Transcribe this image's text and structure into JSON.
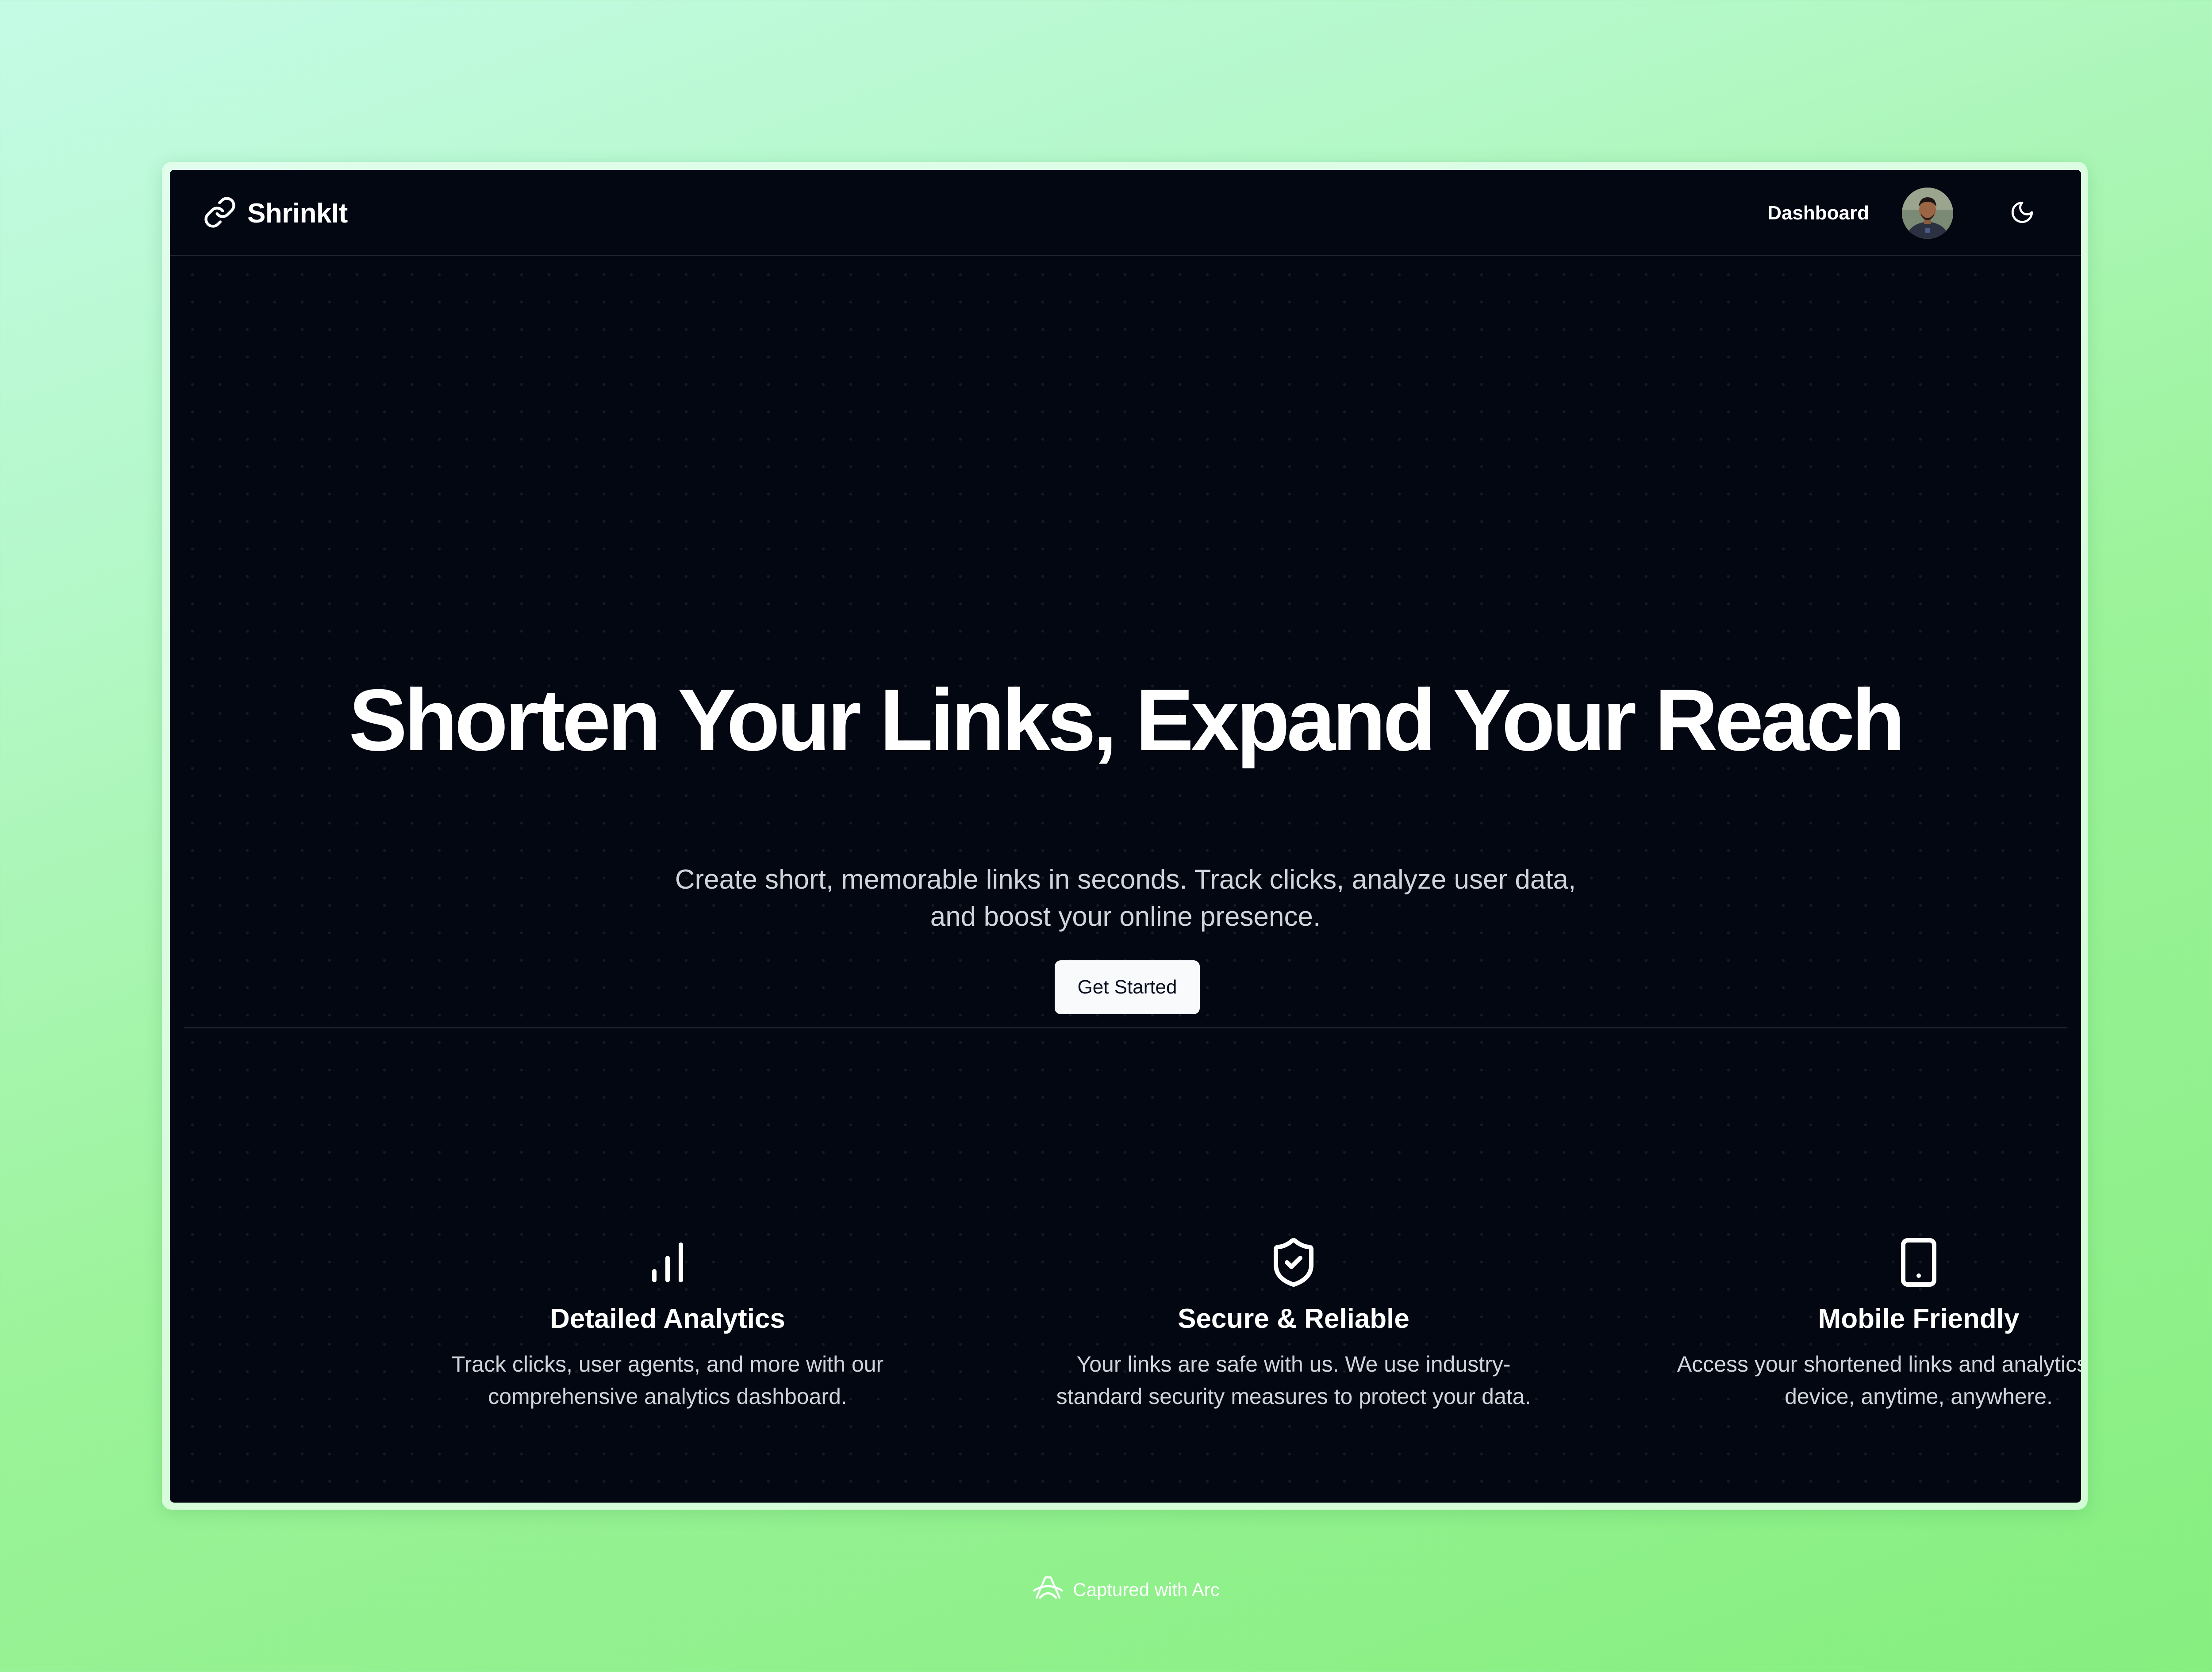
{
  "brand": {
    "name": "ShrinkIt"
  },
  "nav": {
    "dashboard_label": "Dashboard"
  },
  "hero": {
    "title": "Shorten Your Links, Expand Your Reach",
    "subtitle_line1": "Create short, memorable links in seconds. Track clicks, analyze user data,",
    "subtitle_line2": "and boost your online presence.",
    "cta_label": "Get Started"
  },
  "features": [
    {
      "icon": "bar-chart-icon",
      "title": "Detailed Analytics",
      "desc_line1": "Track clicks, user agents, and more with our",
      "desc_line2": "comprehensive analytics dashboard."
    },
    {
      "icon": "shield-check-icon",
      "title": "Secure & Reliable",
      "desc_line1": "Your links are safe with us. We use industry-",
      "desc_line2": "standard security measures to protect your data."
    },
    {
      "icon": "smartphone-icon",
      "title": "Mobile Friendly",
      "desc_line1": "Access your shortened links and analytics on any",
      "desc_line2": "device, anytime, anywhere."
    }
  ],
  "footer": {
    "caption": "Captured with Arc"
  },
  "colors": {
    "app_background": "#030712",
    "text_primary": "#ffffff",
    "text_muted": "#d1d5db",
    "button_background": "#f8fafc",
    "page_gradient_start": "#c4fbe6",
    "page_gradient_end": "#86ef80"
  }
}
